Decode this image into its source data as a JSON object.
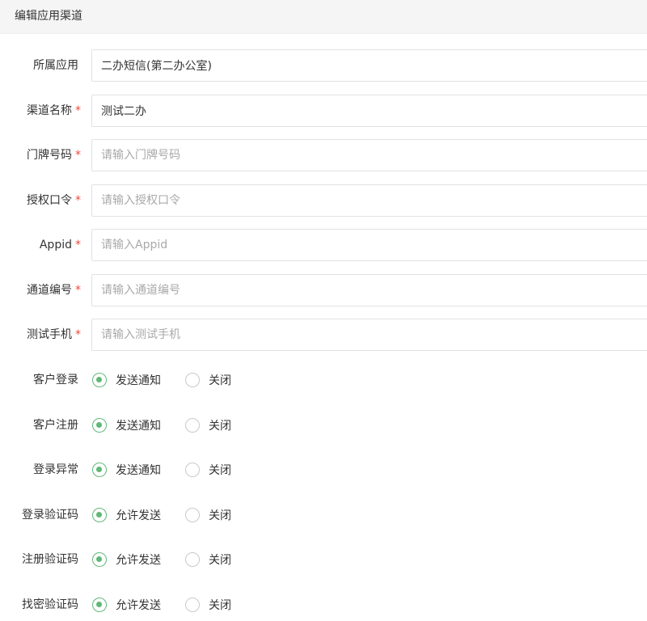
{
  "header": {
    "title": "编辑应用渠道"
  },
  "fields": [
    {
      "label": "所属应用",
      "required": false,
      "value": "二办短信(第二办公室)",
      "placeholder": ""
    },
    {
      "label": "渠道名称",
      "required": true,
      "value": "测试二办",
      "placeholder": ""
    },
    {
      "label": "门牌号码",
      "required": true,
      "value": "",
      "placeholder": "请输入门牌号码"
    },
    {
      "label": "授权口令",
      "required": true,
      "value": "",
      "placeholder": "请输入授权口令"
    },
    {
      "label": "Appid",
      "required": true,
      "value": "",
      "placeholder": "请输入Appid"
    },
    {
      "label": "通道编号",
      "required": true,
      "value": "",
      "placeholder": "请输入通道编号"
    },
    {
      "label": "测试手机",
      "required": true,
      "value": "",
      "placeholder": "请输入测试手机"
    }
  ],
  "required_mark": "*",
  "radios": [
    {
      "label": "客户登录",
      "option_on": "发送通知",
      "option_off": "关闭",
      "selected": "on"
    },
    {
      "label": "客户注册",
      "option_on": "发送通知",
      "option_off": "关闭",
      "selected": "on"
    },
    {
      "label": "登录异常",
      "option_on": "发送通知",
      "option_off": "关闭",
      "selected": "on"
    },
    {
      "label": "登录验证码",
      "option_on": "允许发送",
      "option_off": "关闭",
      "selected": "on"
    },
    {
      "label": "注册验证码",
      "option_on": "允许发送",
      "option_off": "关闭",
      "selected": "on"
    },
    {
      "label": "找密验证码",
      "option_on": "允许发送",
      "option_off": "关闭",
      "selected": "on"
    }
  ],
  "colors": {
    "accent": "#5fb878",
    "required": "#e74c3c",
    "header_bg": "#f5f5f5"
  }
}
